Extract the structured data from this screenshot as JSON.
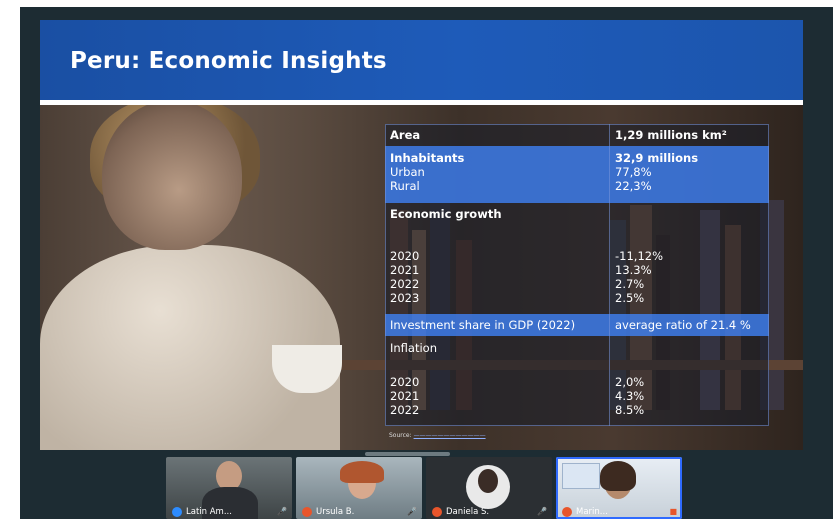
{
  "slide": {
    "title": "Peru: Economic Insights",
    "table": {
      "area": {
        "label": "Area",
        "value": "1,29 millions km²"
      },
      "inhabitants": {
        "label": "Inhabitants",
        "value": "32,9 millions"
      },
      "urban": {
        "label": "Urban",
        "value": "77,8%"
      },
      "rural": {
        "label": "Rural",
        "value": "22,3%"
      },
      "growth_heading": "Economic growth",
      "growth": [
        {
          "year": "2020",
          "value": "-11,12%"
        },
        {
          "year": "2021",
          "value": "13.3%"
        },
        {
          "year": "2022",
          "value": "2.7%"
        },
        {
          "year": "2023",
          "value": "2.5%"
        }
      ],
      "investment": {
        "label": "Investment share in GDP (2022)",
        "value": "average ratio of 21.4 %"
      },
      "inflation_heading": "Inflation",
      "inflation": [
        {
          "year": "2020",
          "value": "2,0%"
        },
        {
          "year": "2021",
          "value": "4.3%"
        },
        {
          "year": "2022",
          "value": "8.5%"
        }
      ]
    },
    "source_label": "Source:"
  },
  "participants": [
    {
      "name": "Latin Am..."
    },
    {
      "name": "Ursula B."
    },
    {
      "name": "Daniela S."
    },
    {
      "name": "Marin..."
    }
  ],
  "colors": {
    "banner": "#1e5bb9",
    "highlight_band": "#3a76de",
    "app_background": "#1d2c33",
    "active_tile_border": "#2f6bff"
  }
}
